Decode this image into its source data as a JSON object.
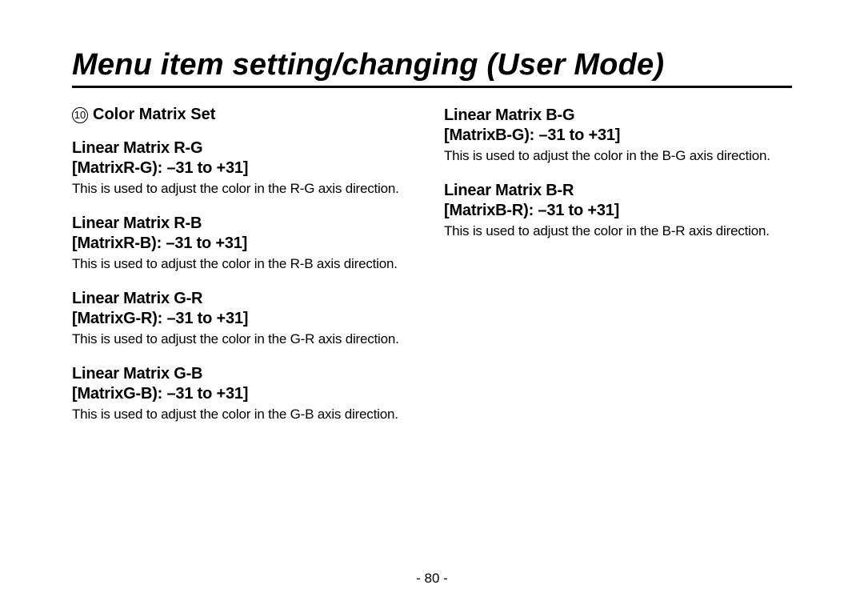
{
  "page_title": "Menu item setting/changing (User Mode)",
  "section_number": "10",
  "section_title": "Color Matrix Set",
  "left_items": [
    {
      "title": "Linear Matrix R-G",
      "range": "[MatrixR-G): –31 to +31]",
      "desc": "This is used to adjust the color in the R-G axis direction."
    },
    {
      "title": "Linear Matrix R-B",
      "range": "[MatrixR-B): –31 to +31]",
      "desc": "This is used to adjust the color in the R-B axis direction."
    },
    {
      "title": "Linear Matrix G-R",
      "range": "[MatrixG-R): –31 to +31]",
      "desc": "This is used to adjust the color in the G-R axis direction."
    },
    {
      "title": "Linear Matrix G-B",
      "range": "[MatrixG-B): –31 to +31]",
      "desc": "This is used to adjust the color in the G-B axis direction."
    }
  ],
  "right_items": [
    {
      "title": "Linear Matrix B-G",
      "range": "[MatrixB-G): –31 to +31]",
      "desc": "This is used to adjust the color in the B-G axis direction."
    },
    {
      "title": "Linear Matrix B-R",
      "range": "[MatrixB-R): –31 to +31]",
      "desc": "This is used to adjust the color in the B-R axis direction."
    }
  ],
  "page_number": "- 80 -"
}
